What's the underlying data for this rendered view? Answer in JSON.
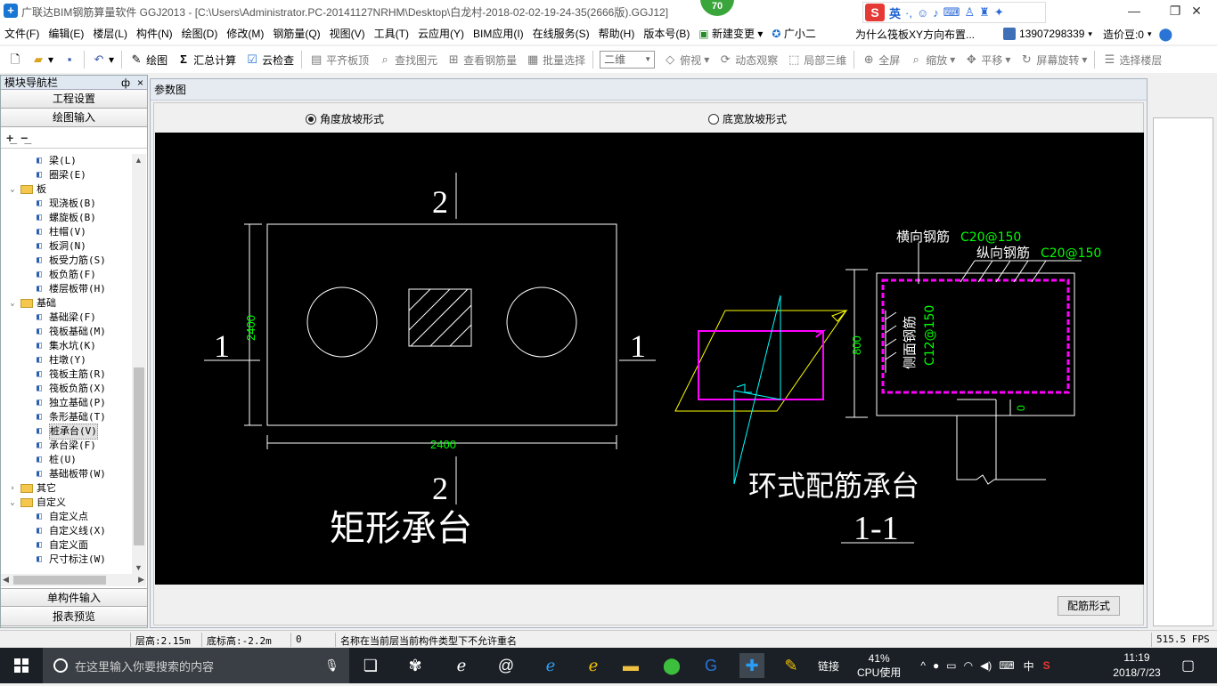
{
  "window": {
    "title": "广联达BIM钢筋算量软件 GGJ2013 - [C:\\Users\\Administrator.PC-20141127NRHM\\Desktop\\白龙村-2018-02-02-19-24-35(2666版).GGJ12]",
    "badge": "70",
    "ime_lang": "英",
    "ime_logo": "S"
  },
  "menu": {
    "items": [
      "文件(F)",
      "编辑(E)",
      "楼层(L)",
      "构件(N)",
      "绘图(D)",
      "修改(M)",
      "钢筋量(Q)",
      "视图(V)",
      "工具(T)",
      "云应用(Y)",
      "BIM应用(I)",
      "在线服务(S)",
      "帮助(H)",
      "版本号(B)",
      "新建变更",
      "广小二"
    ],
    "question": "为什么筏板XY方向布置...",
    "phone": "13907298339",
    "price_label": "造价豆:0"
  },
  "toolbar": {
    "draw": "绘图",
    "sum_calc": "汇总计算",
    "cloud_check": "云检查",
    "level_slab_top": "平齐板顶",
    "find_element": "查找图元",
    "view_rebar": "查看钢筋量",
    "batch_select": "批量选择",
    "view_mode": "二维",
    "top_view": "俯视",
    "dynamic_view": "动态观察",
    "local_3d": "局部三维",
    "full_screen": "全屏",
    "zoom": "缩放",
    "pan": "平移",
    "rotate": "屏幕旋转",
    "select_floor": "选择楼层"
  },
  "nav": {
    "header": "模块导航栏",
    "pin": "ф",
    "close": "×",
    "project_settings": "工程设置",
    "drawing_input": "绘图输入",
    "single_input": "单构件输入",
    "report_preview": "报表预览",
    "tree": [
      {
        "type": "leaf",
        "label": "梁(L)",
        "icon": "beam-icon"
      },
      {
        "type": "leaf",
        "label": "圈梁(E)",
        "icon": "ring-beam-icon"
      },
      {
        "type": "folder",
        "label": "板"
      },
      {
        "type": "leaf",
        "label": "现浇板(B)",
        "icon": "slab-icon"
      },
      {
        "type": "leaf",
        "label": "螺旋板(B)",
        "icon": "spiral-slab-icon"
      },
      {
        "type": "leaf",
        "label": "柱帽(V)",
        "icon": "column-cap-icon"
      },
      {
        "type": "leaf",
        "label": "板洞(N)",
        "icon": "slab-hole-icon"
      },
      {
        "type": "leaf",
        "label": "板受力筋(S)",
        "icon": "slab-rebar-icon"
      },
      {
        "type": "leaf",
        "label": "板负筋(F)",
        "icon": "slab-neg-rebar-icon"
      },
      {
        "type": "leaf",
        "label": "楼层板带(H)",
        "icon": "slab-strip-icon"
      },
      {
        "type": "folder",
        "label": "基础"
      },
      {
        "type": "leaf",
        "label": "基础梁(F)",
        "icon": "foundation-beam-icon"
      },
      {
        "type": "leaf",
        "label": "筏板基础(M)",
        "icon": "raft-icon"
      },
      {
        "type": "leaf",
        "label": "集水坑(K)",
        "icon": "sump-icon"
      },
      {
        "type": "leaf",
        "label": "柱墩(Y)",
        "icon": "pier-icon"
      },
      {
        "type": "leaf",
        "label": "筏板主筋(R)",
        "icon": "raft-main-rebar-icon"
      },
      {
        "type": "leaf",
        "label": "筏板负筋(X)",
        "icon": "raft-neg-rebar-icon"
      },
      {
        "type": "leaf",
        "label": "独立基础(P)",
        "icon": "isolated-footing-icon"
      },
      {
        "type": "leaf",
        "label": "条形基础(T)",
        "icon": "strip-footing-icon"
      },
      {
        "type": "leaf",
        "label": "桩承台(V)",
        "icon": "pile-cap-icon",
        "selected": true
      },
      {
        "type": "leaf",
        "label": "承台梁(F)",
        "icon": "cap-beam-icon"
      },
      {
        "type": "leaf",
        "label": "桩(U)",
        "icon": "pile-icon"
      },
      {
        "type": "leaf",
        "label": "基础板带(W)",
        "icon": "foundation-strip-icon"
      },
      {
        "type": "folder-closed",
        "label": "其它"
      },
      {
        "type": "folder",
        "label": "自定义"
      },
      {
        "type": "leaf",
        "label": "自定义点",
        "icon": "custom-point-icon"
      },
      {
        "type": "leaf",
        "label": "自定义线(X)",
        "icon": "custom-line-icon"
      },
      {
        "type": "leaf",
        "label": "自定义面",
        "icon": "custom-face-icon"
      },
      {
        "type": "leaf",
        "label": "尺寸标注(W)",
        "icon": "dimension-icon"
      }
    ]
  },
  "param": {
    "title": "参数图",
    "radio_angle": "角度放坡形式",
    "radio_bottom_width": "底宽放坡形式",
    "rebar_form_button": "配筋形式"
  },
  "cad": {
    "section_2_top": "2",
    "section_2_bottom": "2",
    "section_1_left": "1",
    "section_1_right": "1",
    "dim_height": "2400",
    "dim_width": "2400",
    "caption_rect": "矩形承台",
    "label_transverse": "横向钢筋",
    "val_transverse": "C20@150",
    "label_longitudinal": "纵向钢筋",
    "val_longitudinal": "C20@150",
    "label_side": "侧面钢筋",
    "val_side": "C12@150",
    "dim_800": "800",
    "dim_0": "0",
    "caption_ring": "环式配筋承台",
    "caption_section": "1-1",
    "colors": {
      "white": "#ffffff",
      "green": "#00ff00",
      "magenta": "#ff00ff",
      "yellow": "#ffff00",
      "cyan": "#00ffff"
    }
  },
  "status": {
    "floor_height": "层高:2.15m",
    "bottom_elev": "底标高:-2.2m",
    "count": "0",
    "message": "名称在当前层当前构件类型下不允许重名",
    "fps": "515.5 FPS"
  },
  "taskbar": {
    "search_placeholder": "在这里输入你要搜索的内容",
    "link": "链接",
    "cpu_percent": "41%",
    "cpu_label": "CPU使用",
    "ime": "中",
    "time": "11:19",
    "date": "2018/7/23"
  }
}
